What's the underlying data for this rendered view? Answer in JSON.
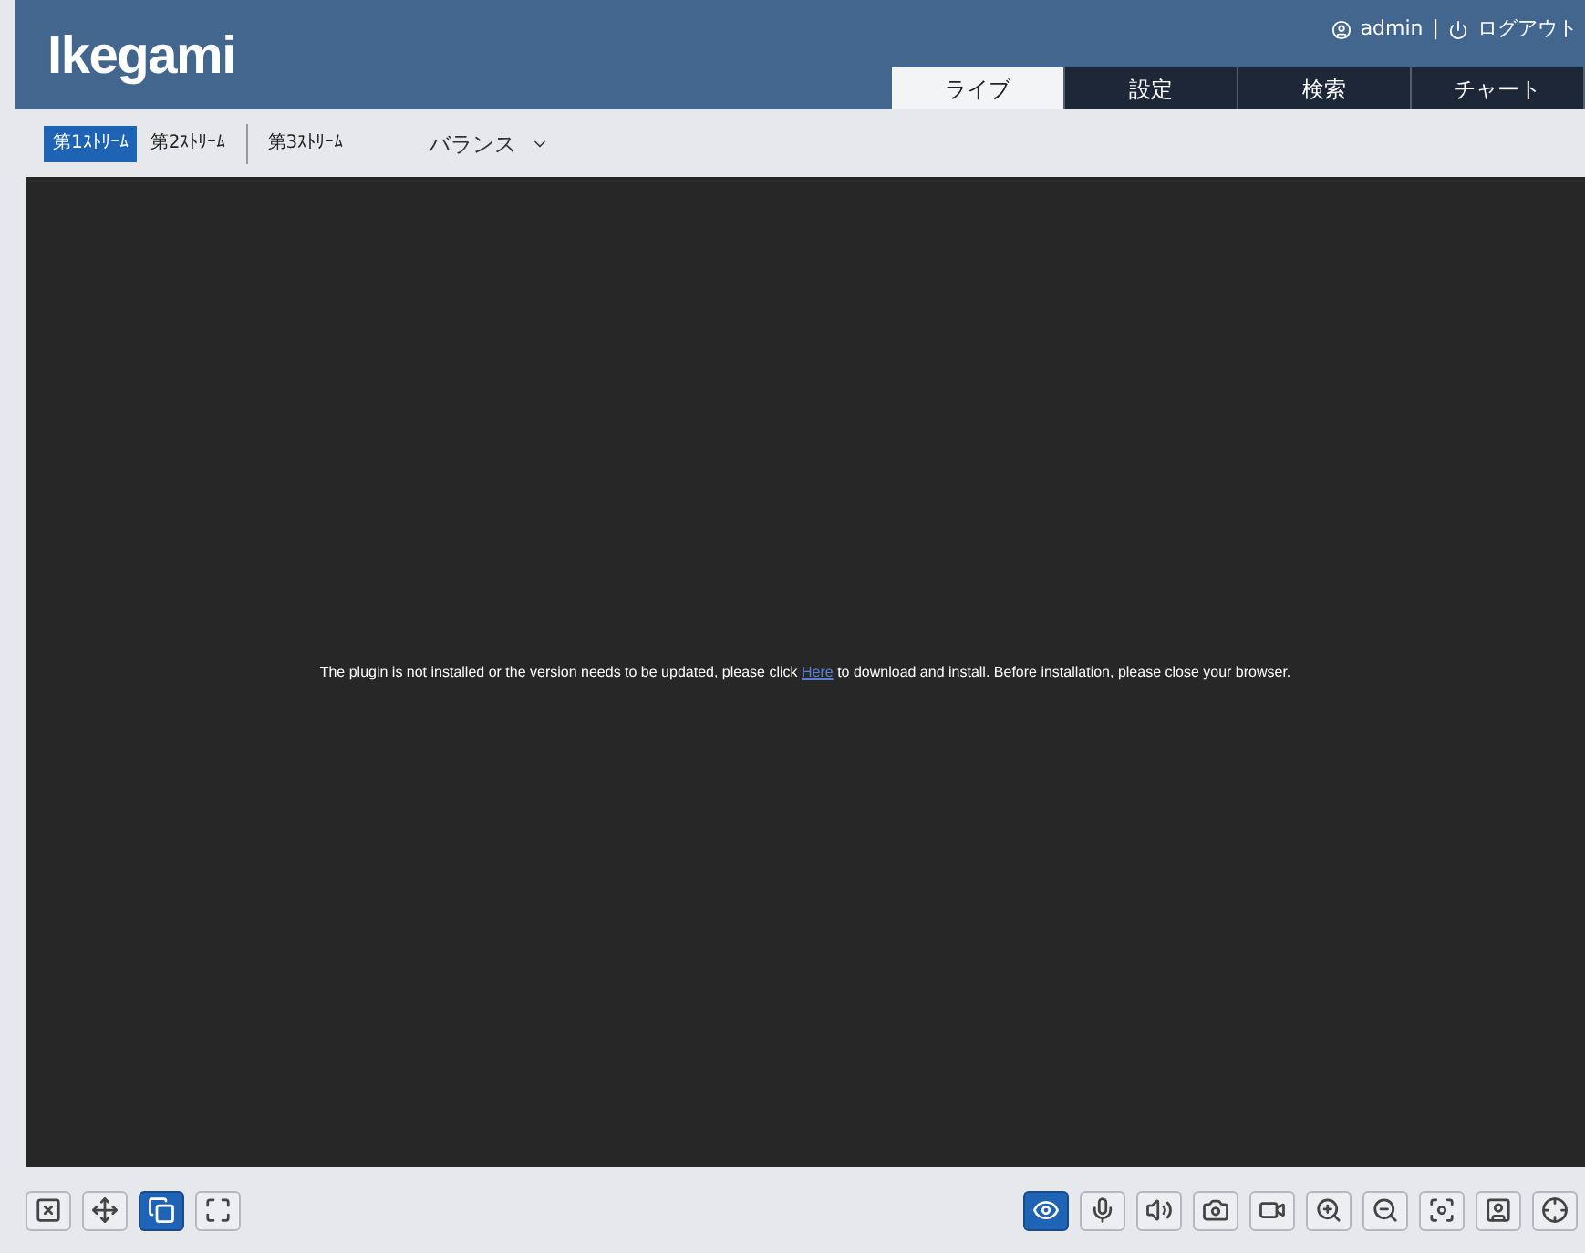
{
  "header": {
    "logo": "Ikegami",
    "user": "admin",
    "separator": "|",
    "logout": "ログアウト"
  },
  "tabs": [
    {
      "label": "ライブ",
      "selected": true
    },
    {
      "label": "設定",
      "selected": false
    },
    {
      "label": "検索",
      "selected": false
    },
    {
      "label": "チャート",
      "selected": false
    }
  ],
  "streams": [
    {
      "label": "第1ｽﾄﾘｰﾑ",
      "selected": true
    },
    {
      "label": "第2ｽﾄﾘｰﾑ",
      "selected": false
    },
    {
      "label": "第3ｽﾄﾘｰﾑ",
      "selected": false
    }
  ],
  "quality": {
    "value": "バランス"
  },
  "video": {
    "message_before": "The plugin is not installed or the version needs to be updated, please click ",
    "link": "Here",
    "message_after": " to download and install. Before installation, please close your browser."
  },
  "left_tools": [
    {
      "kind": "close",
      "selected": false
    },
    {
      "kind": "fit",
      "selected": false
    },
    {
      "kind": "windows",
      "selected": true
    },
    {
      "kind": "fullscreen",
      "selected": false
    }
  ],
  "right_tools": [
    {
      "kind": "view",
      "selected": true
    },
    {
      "kind": "mic",
      "selected": false
    },
    {
      "kind": "speaker",
      "selected": false
    },
    {
      "kind": "snapshot",
      "selected": false
    },
    {
      "kind": "record",
      "selected": false
    },
    {
      "kind": "zoom-in",
      "selected": false
    },
    {
      "kind": "zoom-out",
      "selected": false
    },
    {
      "kind": "focus",
      "selected": false
    },
    {
      "kind": "person",
      "selected": false
    },
    {
      "kind": "ptz",
      "selected": false
    }
  ]
}
